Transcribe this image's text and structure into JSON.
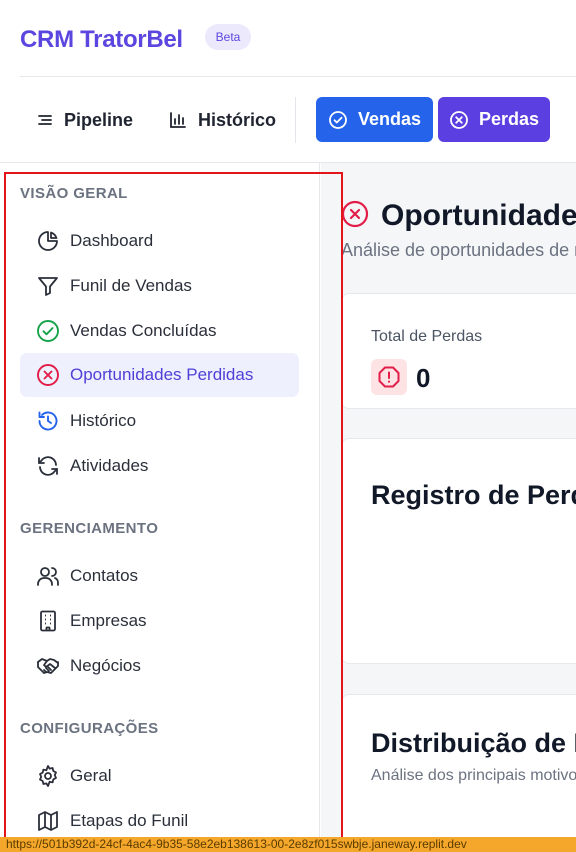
{
  "header": {
    "brand": "CRM TratorBel",
    "badge": "Beta"
  },
  "nav": {
    "pipeline": "Pipeline",
    "historico": "Histórico",
    "vendas": "Vendas",
    "perdas": "Perdas"
  },
  "sidebar": {
    "sections": [
      {
        "title": "VISÃO GERAL",
        "items": [
          {
            "label": "Dashboard",
            "icon": "pie-chart-icon"
          },
          {
            "label": "Funil de Vendas",
            "icon": "funnel-icon"
          },
          {
            "label": "Vendas Concluídas",
            "icon": "check-circle-icon"
          },
          {
            "label": "Oportunidades Perdidas",
            "icon": "x-circle-icon",
            "active": true
          },
          {
            "label": "Histórico",
            "icon": "history-icon"
          },
          {
            "label": "Atividades",
            "icon": "refresh-icon"
          }
        ]
      },
      {
        "title": "GERENCIAMENTO",
        "items": [
          {
            "label": "Contatos",
            "icon": "users-icon"
          },
          {
            "label": "Empresas",
            "icon": "building-icon"
          },
          {
            "label": "Negócios",
            "icon": "handshake-icon"
          }
        ]
      },
      {
        "title": "CONFIGURAÇÕES",
        "items": [
          {
            "label": "Geral",
            "icon": "gear-icon"
          },
          {
            "label": "Etapas do Funil",
            "icon": "map-icon"
          }
        ]
      }
    ]
  },
  "main": {
    "title": "Oportunidades Perdidas",
    "subtitle": "Análise de oportunidades de negócio perdidas",
    "total_label": "Total de Perdas",
    "total_value": "0",
    "registro_title": "Registro de Perdas",
    "distrib_title": "Distribuição de Motivos",
    "distrib_sub": "Análise dos principais motivos de perda"
  },
  "statusbar": {
    "url": "https://501b392d-24cf-4ac4-9b35-58e2eb138613-00-2e8zf015swbje.janeway.replit.dev"
  },
  "colors": {
    "brand": "#5b47e0",
    "vendas_button": "#2563eb",
    "perdas_button": "#5b3fe0",
    "active_item_bg": "#eef0fe",
    "danger": "#e11d48",
    "success": "#16a34a",
    "info": "#2563eb"
  }
}
